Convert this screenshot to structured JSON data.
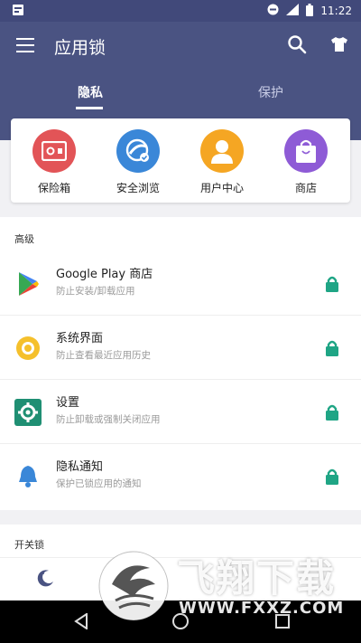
{
  "statusbar": {
    "time": "11:22"
  },
  "header": {
    "title": "应用锁"
  },
  "tabs": [
    {
      "label": "隐私"
    },
    {
      "label": "保护"
    }
  ],
  "quick_actions": [
    {
      "label": "保险箱",
      "icon": "safe-icon",
      "color": "#e25457"
    },
    {
      "label": "安全浏览",
      "icon": "secure-browser-icon",
      "color": "#3a87d8"
    },
    {
      "label": "用户中心",
      "icon": "user-icon",
      "color": "#f5a623"
    },
    {
      "label": "商店",
      "icon": "shopping-bag-icon",
      "color": "#8e5bd6"
    }
  ],
  "advanced": {
    "title": "高级",
    "items": [
      {
        "name": "Google Play 商店",
        "desc": "防止安装/卸载应用",
        "icon": "google-play-icon"
      },
      {
        "name": "系统界面",
        "desc": "防止查看最近应用历史",
        "icon": "system-ui-icon"
      },
      {
        "name": "设置",
        "desc": "防止卸载或强制关闭应用",
        "icon": "settings-icon"
      },
      {
        "name": "隐私通知",
        "desc": "保护已锁应用的通知",
        "icon": "bell-icon"
      }
    ]
  },
  "switch_lock": {
    "title": "开关锁"
  },
  "watermark": {
    "cn": "飞翔下载",
    "url": "WWW.FXXZ.COM"
  },
  "colors": {
    "header": "#4a5382",
    "lock": "#1fa585"
  }
}
